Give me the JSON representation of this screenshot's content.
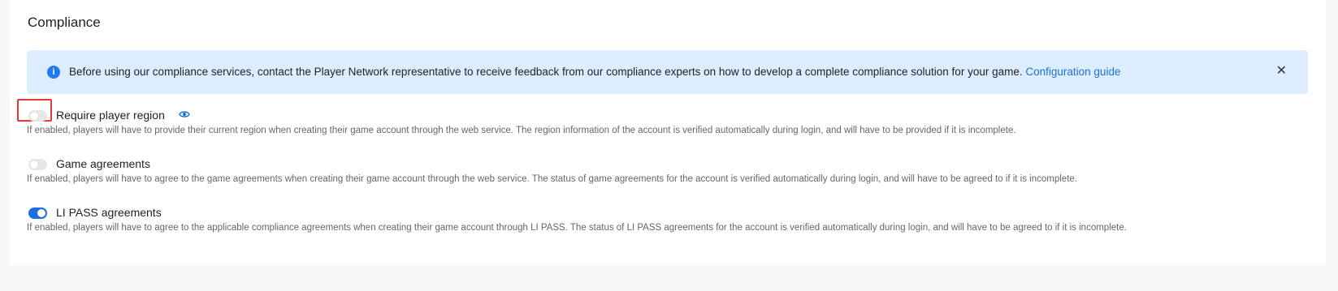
{
  "section": {
    "title": "Compliance"
  },
  "alert": {
    "text": "Before using our compliance services, contact the Player Network representative to receive feedback from our compliance experts on how to develop a complete compliance solution for your game.",
    "link": "Configuration guide",
    "icon": "info-icon",
    "close_icon": "close-icon"
  },
  "options": [
    {
      "label": "Require player region",
      "enabled": false,
      "has_preview_icon": true,
      "description": "If enabled, players will have to provide their current region when creating their game account through the web service. The region information of the account is verified automatically during login, and will have to be provided if it is incomplete."
    },
    {
      "label": "Game agreements",
      "enabled": false,
      "description": "If enabled, players will have to agree to the game agreements when creating their game account through the web service. The status of game agreements for the account is verified automatically during login, and will have to be agreed to if it is incomplete."
    },
    {
      "label": "LI PASS agreements",
      "enabled": true,
      "description": "If enabled, players will have to agree to the applicable compliance agreements when creating their game account through LI PASS. The status of LI PASS agreements for the account is verified automatically during login, and will have to be agreed to if it is incomplete."
    }
  ],
  "colors": {
    "accent": "#1e6fdc",
    "alert_bg": "#dcedff",
    "highlight": "#e53935"
  }
}
